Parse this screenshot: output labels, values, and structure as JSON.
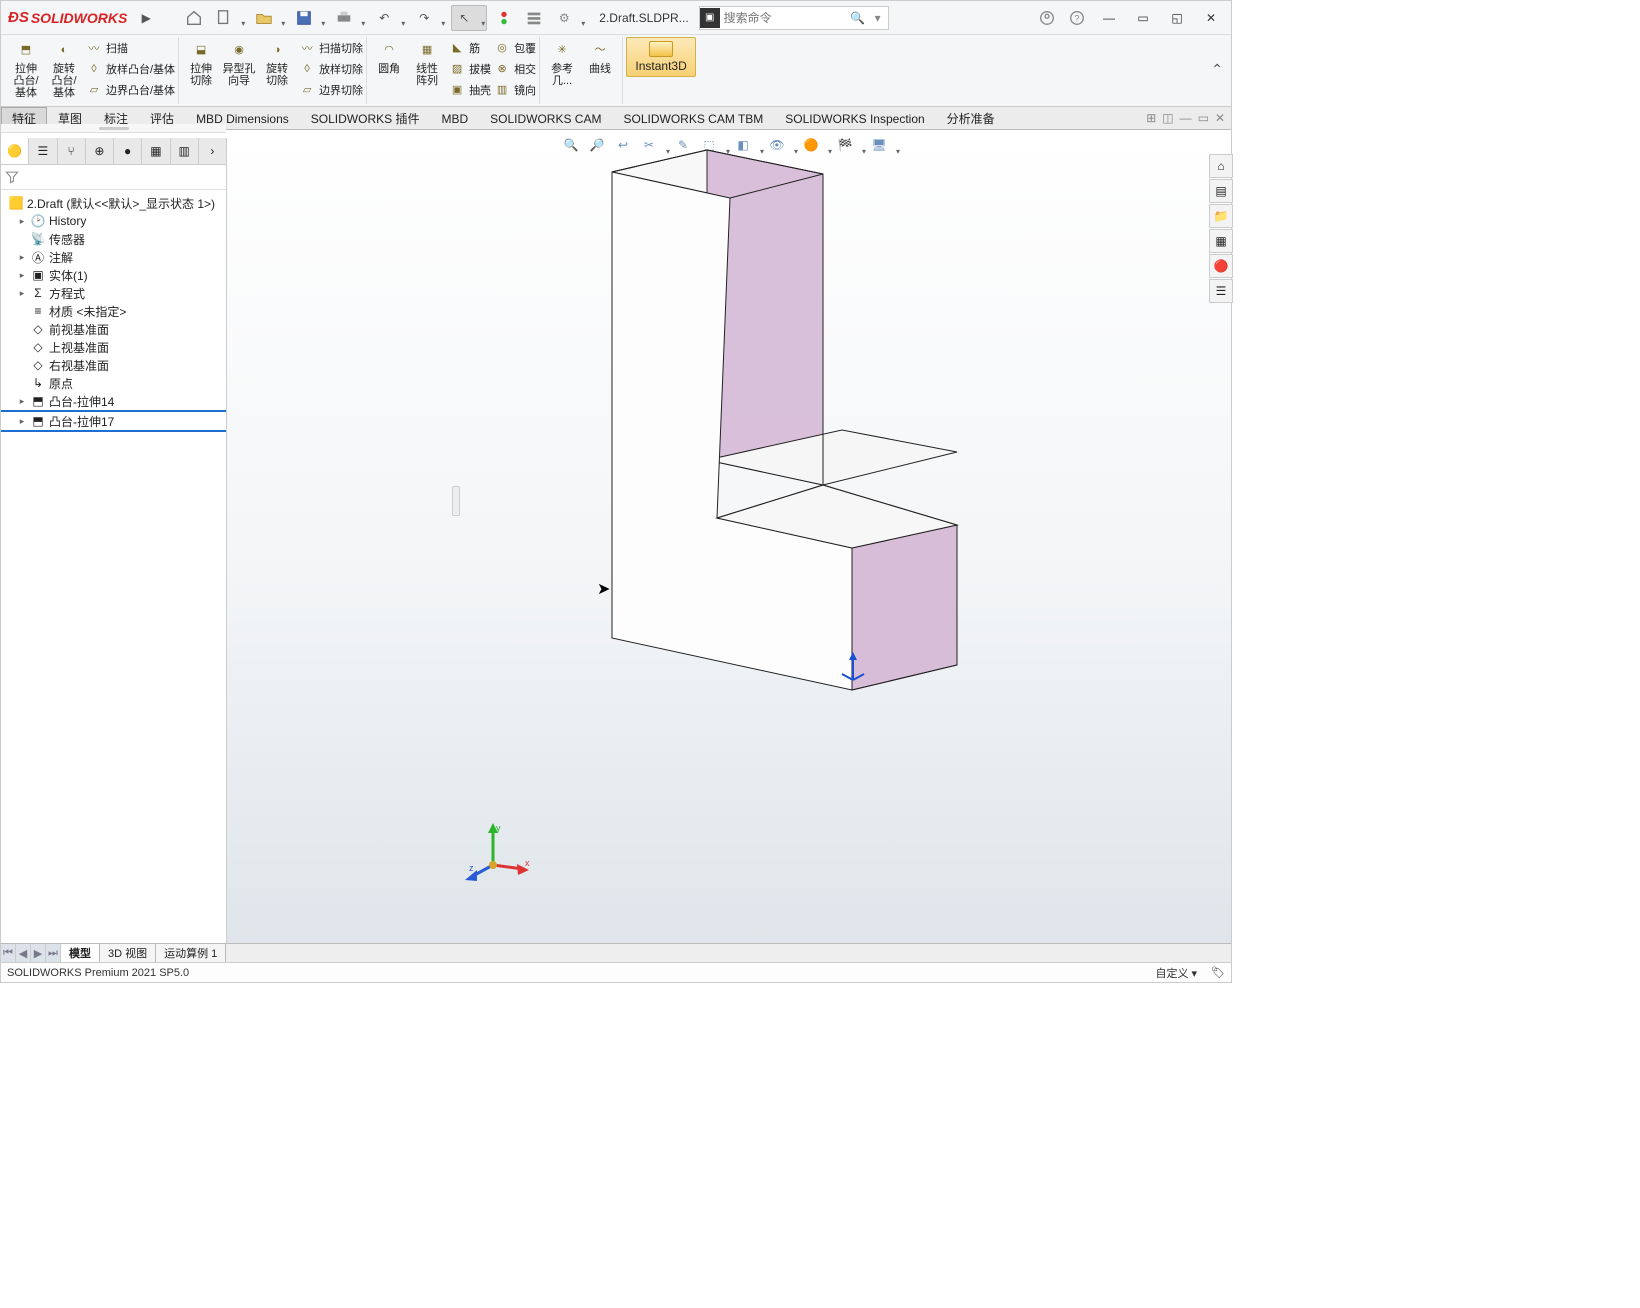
{
  "titlebar": {
    "product": "SOLIDWORKS",
    "filename": "2.Draft.SLDPR...",
    "search_placeholder": "搜索命令"
  },
  "ribbon": {
    "extrude_boss": "拉伸\n凸台/\n基体",
    "revolve_boss": "旋转\n凸台/\n基体",
    "swept_boss": "扫描",
    "lofted_boss": "放样凸台/基体",
    "boundary_boss": "边界凸台/基体",
    "extrude_cut": "拉伸\n切除",
    "hole_wizard": "异型孔\n向导",
    "revolve_cut": "旋转\n切除",
    "swept_cut": "扫描切除",
    "lofted_cut": "放样切除",
    "boundary_cut": "边界切除",
    "fillet": "圆角",
    "linear_pattern": "线性\n阵列",
    "rib": "筋",
    "draft": "拔模",
    "shell": "抽壳",
    "wrap": "包覆",
    "intersect": "相交",
    "mirror": "镜向",
    "ref_geom": "参考\n几...",
    "curves": "曲线",
    "instant3d": "Instant3D"
  },
  "cmdtabs": [
    "特征",
    "草图",
    "标注",
    "评估",
    "MBD Dimensions",
    "SOLIDWORKS 插件",
    "MBD",
    "SOLIDWORKS CAM",
    "SOLIDWORKS CAM TBM",
    "SOLIDWORKS Inspection",
    "分析准备"
  ],
  "tree": {
    "root": "2.Draft  (默认<<默认>_显示状态 1>)",
    "items": [
      {
        "label": "History",
        "icon": "history",
        "exp": "▸",
        "lvl": 1
      },
      {
        "label": "传感器",
        "icon": "sensor",
        "exp": "",
        "lvl": 1
      },
      {
        "label": "注解",
        "icon": "annot",
        "exp": "▸",
        "lvl": 1
      },
      {
        "label": "实体(1)",
        "icon": "solid",
        "exp": "▸",
        "lvl": 1
      },
      {
        "label": "方程式",
        "icon": "eq",
        "exp": "▸",
        "lvl": 1
      },
      {
        "label": "材质 <未指定>",
        "icon": "mat",
        "exp": "",
        "lvl": 1
      },
      {
        "label": "前视基准面",
        "icon": "plane",
        "exp": "",
        "lvl": 1
      },
      {
        "label": "上视基准面",
        "icon": "plane",
        "exp": "",
        "lvl": 1
      },
      {
        "label": "右视基准面",
        "icon": "plane",
        "exp": "",
        "lvl": 1
      },
      {
        "label": "原点",
        "icon": "origin",
        "exp": "",
        "lvl": 1
      },
      {
        "label": "凸台-拉伸14",
        "icon": "extr",
        "exp": "▸",
        "lvl": 1
      },
      {
        "label": "凸台-拉伸17",
        "icon": "extr",
        "exp": "▸",
        "lvl": 1,
        "selected": true
      }
    ]
  },
  "doctabs": [
    "模型",
    "3D 视图",
    "运动算例 1"
  ],
  "status": {
    "left": "SOLIDWORKS Premium 2021 SP5.0",
    "custom": "自定义"
  },
  "triad": {
    "x": "x",
    "y": "y",
    "z": "z"
  }
}
